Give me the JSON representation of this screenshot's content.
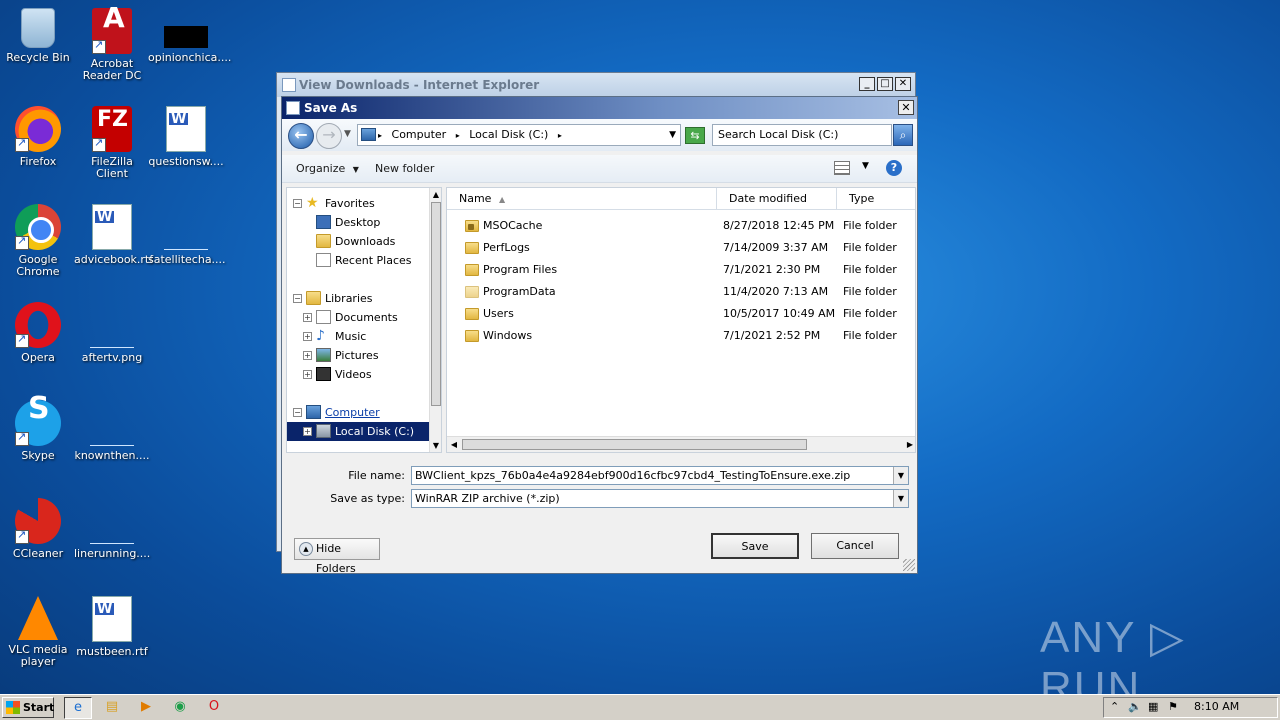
{
  "desktop": {
    "icons": [
      {
        "label": "Recycle Bin",
        "icon": "recycle-bin-icon"
      },
      {
        "label": "Acrobat Reader DC",
        "icon": "acrobat-icon"
      },
      {
        "label": "opinionchica....",
        "icon": "image-file-icon"
      },
      {
        "label": "Firefox",
        "icon": "firefox-icon"
      },
      {
        "label": "FileZilla Client",
        "icon": "filezilla-icon"
      },
      {
        "label": "questionsw....",
        "icon": "word-doc-icon"
      },
      {
        "label": "Google Chrome",
        "icon": "chrome-icon"
      },
      {
        "label": "advicebook.rtf",
        "icon": "word-doc-icon"
      },
      {
        "label": "satellitecha....",
        "icon": "blank-file-icon"
      },
      {
        "label": "Opera",
        "icon": "opera-icon"
      },
      {
        "label": "aftertv.png",
        "icon": "blank-file-icon"
      },
      {
        "label": "Skype",
        "icon": "skype-icon"
      },
      {
        "label": "knownthen....",
        "icon": "blank-file-icon"
      },
      {
        "label": "CCleaner",
        "icon": "ccleaner-icon"
      },
      {
        "label": "linerunning....",
        "icon": "blank-file-icon"
      },
      {
        "label": "VLC media player",
        "icon": "vlc-icon"
      },
      {
        "label": "mustbeen.rtf",
        "icon": "word-doc-icon"
      }
    ],
    "watermark": "ANY ▷ RUN"
  },
  "ie_window": {
    "title": "View Downloads - Internet Explorer"
  },
  "dialog": {
    "title": "Save As",
    "address": {
      "crumbs": [
        "Computer",
        "Local Disk (C:)"
      ],
      "search_placeholder": "Search Local Disk (C:)"
    },
    "toolbar": {
      "organize": "Organize",
      "new_folder": "New folder"
    },
    "nav_tree": [
      {
        "label": "Favorites",
        "icon": "star-icon"
      },
      {
        "label": "Desktop",
        "icon": "desktop-icon"
      },
      {
        "label": "Downloads",
        "icon": "folder-icon"
      },
      {
        "label": "Recent Places",
        "icon": "recent-places-icon"
      },
      {
        "label": "Libraries",
        "icon": "folder-icon"
      },
      {
        "label": "Documents",
        "icon": "documents-icon"
      },
      {
        "label": "Music",
        "icon": "music-icon"
      },
      {
        "label": "Pictures",
        "icon": "pictures-icon"
      },
      {
        "label": "Videos",
        "icon": "videos-icon"
      },
      {
        "label": "Computer",
        "icon": "computer-icon"
      },
      {
        "label": "Local Disk (C:)",
        "icon": "disk-icon"
      }
    ],
    "columns": {
      "name": "Name",
      "date": "Date modified",
      "type": "Type"
    },
    "files": [
      {
        "name": "MSOCache",
        "date": "8/27/2018 12:45 PM",
        "type": "File folder"
      },
      {
        "name": "PerfLogs",
        "date": "7/14/2009 3:37 AM",
        "type": "File folder"
      },
      {
        "name": "Program Files",
        "date": "7/1/2021 2:30 PM",
        "type": "File folder"
      },
      {
        "name": "ProgramData",
        "date": "11/4/2020 7:13 AM",
        "type": "File folder"
      },
      {
        "name": "Users",
        "date": "10/5/2017 10:49 AM",
        "type": "File folder"
      },
      {
        "name": "Windows",
        "date": "7/1/2021 2:52 PM",
        "type": "File folder"
      }
    ],
    "file_name_label": "File name:",
    "file_name_value": "BWClient_kpzs_76b0a4e4a9284ebf900d16cfbc97cbd4_TestingToEnsure.exe.zip",
    "save_type_label": "Save as type:",
    "save_type_value": "WinRAR ZIP archive (*.zip)",
    "hide_folders": "Hide Folders",
    "save": "Save",
    "cancel": "Cancel"
  },
  "taskbar": {
    "start": "Start",
    "clock": "8:10 AM"
  }
}
